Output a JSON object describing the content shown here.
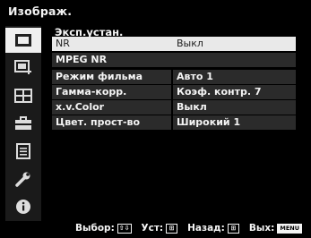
{
  "window": {
    "title": "Изображ."
  },
  "sidebar": {
    "items": [
      {
        "icon": "picture-icon",
        "active": true
      },
      {
        "icon": "picture-settings-icon",
        "active": false
      },
      {
        "icon": "screen-grid-icon",
        "active": false
      },
      {
        "icon": "toolbox-icon",
        "active": false
      },
      {
        "icon": "list-icon",
        "active": false
      },
      {
        "icon": "wrench-icon",
        "active": false
      },
      {
        "icon": "info-icon",
        "active": false
      }
    ]
  },
  "menu": {
    "title": "Эксп.устан.",
    "rows": [
      {
        "name": "NR",
        "value": "Выкл",
        "selected": true
      },
      {
        "name": "MPEG NR",
        "value": "",
        "selected": false
      },
      {
        "name": "Режим фильма",
        "value": "Авто 1",
        "selected": false
      },
      {
        "name": "Гамма-корр.",
        "value": "Коэф. контр. 7",
        "selected": false
      },
      {
        "name": "x.v.Color",
        "value": "Выкл",
        "selected": false
      },
      {
        "name": "Цвет. прост-во",
        "value": "Широкий 1",
        "selected": false
      }
    ]
  },
  "footer": {
    "select_label": "Выбор:",
    "select_keys": "⇧⇩",
    "set_label": "Уст:",
    "set_key": "⊞",
    "back_label": "Назад:",
    "back_key": "⊞",
    "exit_label": "Вых:",
    "exit_key": "MENU"
  },
  "colors": {
    "background": "#000000",
    "row_bg": "#2b2b2b",
    "row_selected_bg": "#e9e9e9",
    "text": "#f4f4f4"
  }
}
